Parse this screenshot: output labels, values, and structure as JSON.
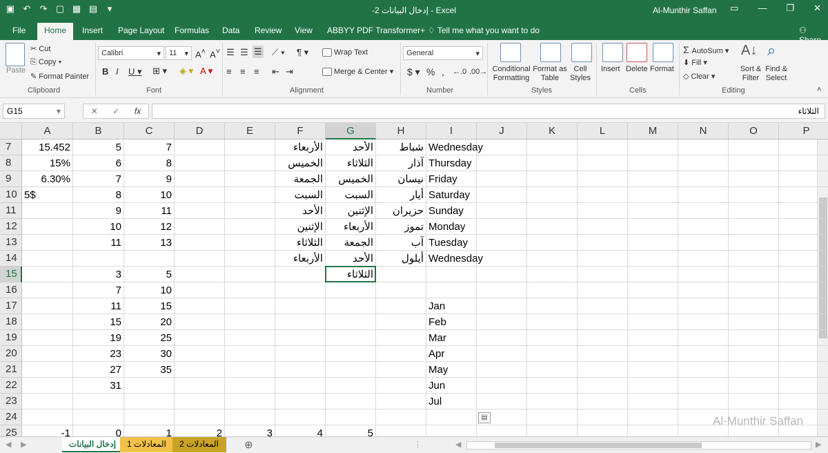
{
  "titlebar": {
    "title": "-2 إدخال البيانات - Excel",
    "user": "Al-Munthir Saffan"
  },
  "tabs": [
    "File",
    "Home",
    "Insert",
    "Page Layout",
    "Formulas",
    "Data",
    "Review",
    "View",
    "ABBYY PDF Transformer+",
    "Tell me what you want to do"
  ],
  "share": "Share",
  "ribbon": {
    "clipboard": {
      "paste": "Paste",
      "cut": "Cut",
      "copy": "Copy",
      "format_painter": "Format Painter",
      "label": "Clipboard"
    },
    "font": {
      "name": "Calibri",
      "size": "11",
      "label": "Font"
    },
    "alignment": {
      "wrap": "Wrap Text",
      "merge": "Merge & Center",
      "label": "Alignment"
    },
    "number": {
      "format": "General",
      "label": "Number"
    },
    "styles": {
      "conditional": "Conditional Formatting",
      "format_table": "Format as Table",
      "cell_styles": "Cell Styles",
      "label": "Styles"
    },
    "cells": {
      "insert": "Insert",
      "delete": "Delete",
      "format": "Format",
      "label": "Cells"
    },
    "editing": {
      "autosum": "AutoSum",
      "fill": "Fill",
      "clear": "Clear",
      "sort": "Sort & Filter",
      "find": "Find & Select",
      "label": "Editing"
    }
  },
  "formula": {
    "namebox": "G15",
    "value": "الثلاثاء"
  },
  "columns": [
    "A",
    "B",
    "C",
    "D",
    "E",
    "F",
    "G",
    "H",
    "I",
    "J",
    "K",
    "L",
    "M",
    "N",
    "O",
    "P"
  ],
  "rows": [
    "7",
    "8",
    "9",
    "10",
    "11",
    "12",
    "13",
    "14",
    "15",
    "16",
    "17",
    "18",
    "19",
    "20",
    "21",
    "22",
    "23",
    "24",
    "25"
  ],
  "cells": {
    "A7": "15.452",
    "B7": "5",
    "C7": "7",
    "F7": "الأربعاء",
    "G7": "الأحد",
    "H7": "شباط",
    "I7": "Wednesday",
    "A8": "15%",
    "B8": "6",
    "C8": "8",
    "F8": "الخميس",
    "G8": "الثلاثاء",
    "H8": "آذار",
    "I8": "Thursday",
    "A9": "6.30%",
    "B9": "7",
    "C9": "9",
    "F9": "الجمعة",
    "G9": "الخميس",
    "H9": "نيسان",
    "I9": "Friday",
    "A10": "5$",
    "B10": "8",
    "C10": "10",
    "F10": "السبت",
    "G10": "السبت",
    "H10": "أيار",
    "I10": "Saturday",
    "B11": "9",
    "C11": "11",
    "F11": "الأحد",
    "G11": "الإثنين",
    "H11": "حزيران",
    "I11": "Sunday",
    "B12": "10",
    "C12": "12",
    "F12": "الإثنين",
    "G12": "الأربعاء",
    "H12": "تموز",
    "I12": "Monday",
    "B13": "11",
    "C13": "13",
    "F13": "الثلاثاء",
    "G13": "الجمعة",
    "H13": "آب",
    "I13": "Tuesday",
    "F14": "الأربعاء",
    "G14": "الأحد",
    "H14": "أيلول",
    "I14": "Wednesday",
    "B15": "3",
    "C15": "5",
    "G15": "الثلاثاء",
    "B16": "7",
    "C16": "10",
    "B17": "11",
    "C17": "15",
    "I17": "Jan",
    "B18": "15",
    "C18": "20",
    "I18": "Feb",
    "B19": "19",
    "C19": "25",
    "I19": "Mar",
    "B20": "23",
    "C20": "30",
    "I20": "Apr",
    "B21": "27",
    "C21": "35",
    "I21": "May",
    "B22": "31",
    "I22": "Jun",
    "I23": "Jul",
    "A25": "-1",
    "B25": "0",
    "C25": "1",
    "D25": "2",
    "E25": "3",
    "F25": "4",
    "G25": "5"
  },
  "sheets": [
    "إدخال البيانات",
    "المعادلات 1",
    "المعادلات 2"
  ],
  "watermark": "Al-Munthir Saffan"
}
